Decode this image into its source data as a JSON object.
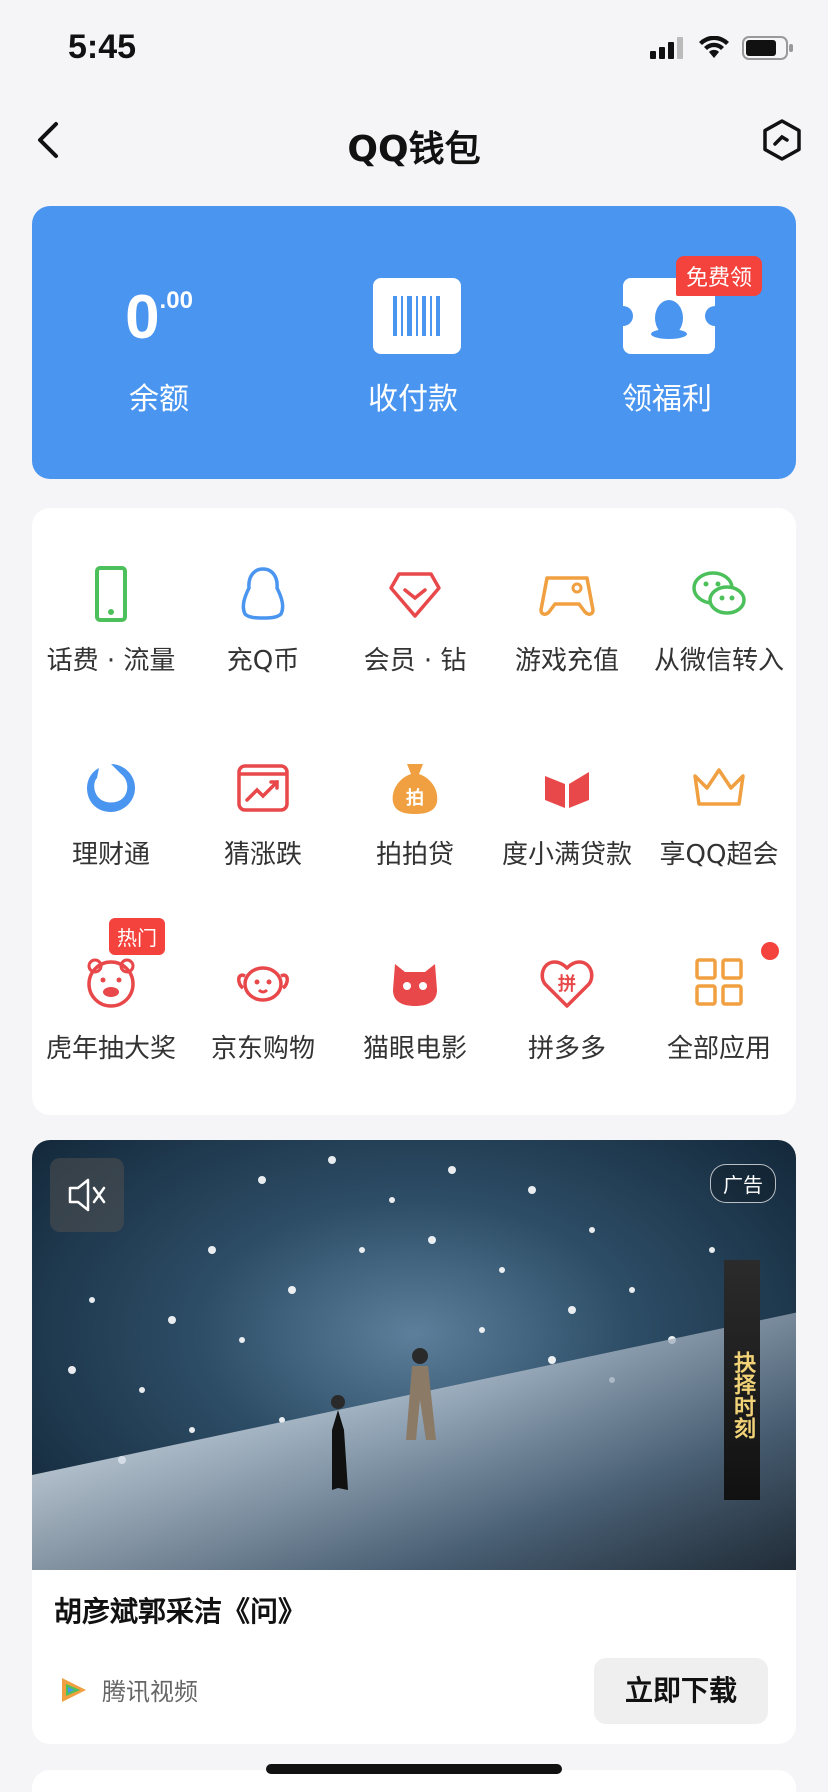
{
  "status": {
    "time": "5:45"
  },
  "nav": {
    "title": "QQ钱包"
  },
  "wallet": {
    "balance_int": "0",
    "balance_dec": ".00",
    "balance_label": "余额",
    "pay_label": "收付款",
    "welfare_label": "领福利",
    "free_badge": "免费领"
  },
  "services": {
    "row1": [
      "话费 · 流量",
      "充Q币",
      "会员 · 钻",
      "游戏充值",
      "从微信转入"
    ],
    "row2": [
      "理财通",
      "猜涨跌",
      "拍拍贷",
      "度小满贷款",
      "享QQ超会"
    ],
    "row3": [
      "虎年抽大奖",
      "京东购物",
      "猫眼电影",
      "拼多多",
      "全部应用"
    ],
    "hot_badge": "热门"
  },
  "ad": {
    "tag": "广告",
    "side_banner": "抉择时刻",
    "title": "胡彦斌郭采洁《问》",
    "source": "腾讯视频",
    "cta": "立即下载"
  },
  "colors": {
    "wallet_blue": "#4a95f0",
    "badge_red": "#f4433c",
    "icon_green": "#4cc05a",
    "icon_blue": "#4a95f0",
    "icon_red": "#e8484a",
    "icon_orange": "#f0a040"
  }
}
